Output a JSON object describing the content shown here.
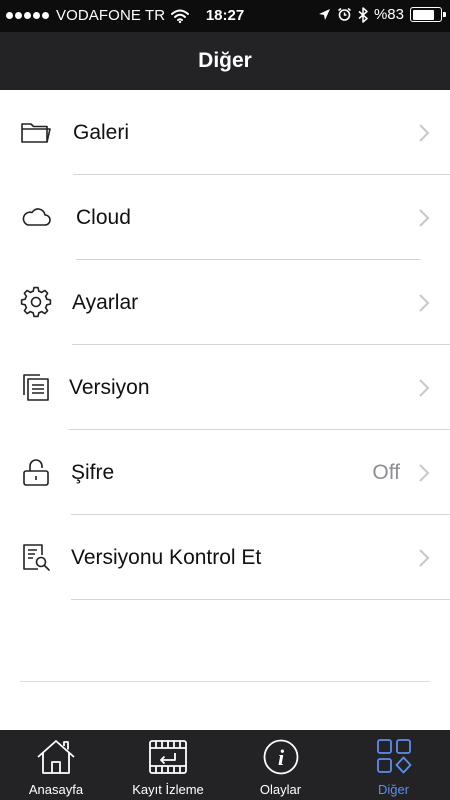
{
  "status_bar": {
    "carrier": "VODAFONE TR",
    "time": "18:27",
    "battery": "%83",
    "battery_level": 0.83
  },
  "header": {
    "title": "Diğer"
  },
  "menu": {
    "items": [
      {
        "label": "Galeri",
        "icon": "folder-icon"
      },
      {
        "label": "Cloud",
        "icon": "cloud-icon"
      },
      {
        "label": "Ayarlar",
        "icon": "gear-icon"
      },
      {
        "label": "Versiyon",
        "icon": "documents-icon"
      },
      {
        "label": "Şifre",
        "icon": "lock-icon",
        "value": "Off"
      },
      {
        "label": "Versiyonu Kontrol Et",
        "icon": "document-search-icon"
      }
    ]
  },
  "tabbar": {
    "items": [
      {
        "label": "Anasayfa",
        "icon": "house-icon"
      },
      {
        "label": "Kayıt İzleme",
        "icon": "playback-icon"
      },
      {
        "label": "Olaylar",
        "icon": "info-icon"
      },
      {
        "label": "Diğer",
        "icon": "grid-icon",
        "active": true
      }
    ]
  },
  "colors": {
    "bar_background": "#232326",
    "active_tab": "#5b8ef0",
    "secondary_text": "#8e8e93",
    "divider": "#d5d5d8"
  }
}
